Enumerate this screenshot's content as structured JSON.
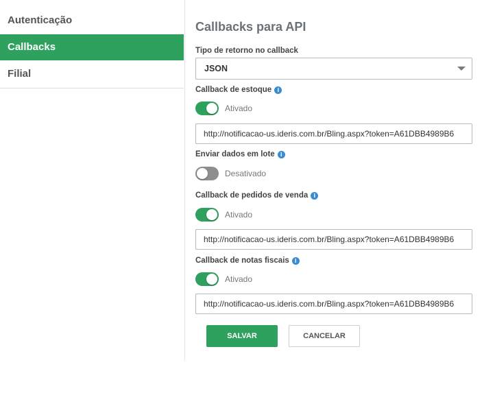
{
  "sidebar": {
    "items": [
      {
        "label": "Autenticação"
      },
      {
        "label": "Callbacks"
      },
      {
        "label": "Filial"
      }
    ]
  },
  "main": {
    "title": "Callbacks para API",
    "return_type": {
      "label": "Tipo de retorno no callback",
      "selected": "JSON"
    },
    "stock_callback": {
      "label": "Callback de estoque",
      "toggle_state": "Ativado",
      "url": "http://notificacao-us.ideris.com.br/Bling.aspx?token=A61DBB4989B6"
    },
    "batch": {
      "label": "Enviar dados em lote",
      "toggle_state": "Desativado"
    },
    "orders_callback": {
      "label": "Callback de pedidos de venda",
      "toggle_state": "Ativado",
      "url": "http://notificacao-us.ideris.com.br/Bling.aspx?token=A61DBB4989B6"
    },
    "invoices_callback": {
      "label": "Callback de notas fiscais",
      "toggle_state": "Ativado",
      "url": "http://notificacao-us.ideris.com.br/Bling.aspx?token=A61DBB4989B6"
    },
    "buttons": {
      "save": "SALVAR",
      "cancel": "CANCELAR"
    },
    "info_glyph": "i"
  },
  "colors": {
    "accent": "#2fa15e",
    "info": "#3a8bd1",
    "toggle_off": "#8e8e8e"
  },
  "icons": {
    "info": "info-icon",
    "dropdown": "chevron-down-icon"
  }
}
